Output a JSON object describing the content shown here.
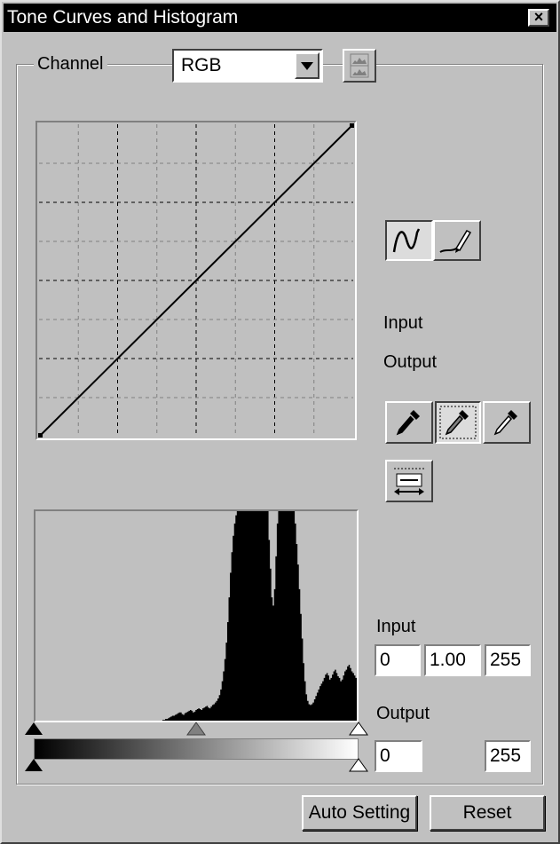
{
  "window": {
    "title": "Tone Curves and Histogram"
  },
  "channel": {
    "label": "Channel",
    "selected": "RGB"
  },
  "curve": {
    "points": [
      [
        0,
        0
      ],
      [
        255,
        255
      ]
    ]
  },
  "readout": {
    "input_label": "Input",
    "output_label": "Output"
  },
  "levels": {
    "input_label": "Input",
    "input_black": "0",
    "input_gamma": "1.00",
    "input_white": "255",
    "output_label": "Output",
    "output_black": "0",
    "output_white": "255"
  },
  "buttons": {
    "auto_setting": "Auto Setting",
    "reset": "Reset"
  },
  "icons": {
    "close": "close-icon",
    "histogram_toggle": "histogram-icon",
    "curve_tool": "curve-icon",
    "pencil_tool": "pencil-icon",
    "black_point": "eyedropper-black-icon",
    "gray_point": "eyedropper-gray-icon",
    "white_point": "eyedropper-white-icon",
    "auto_range": "auto-range-icon"
  },
  "histogram": {
    "values": [
      0,
      0,
      0,
      0,
      0,
      0,
      0,
      0,
      0,
      0,
      0,
      0,
      0,
      0,
      0,
      0,
      0,
      0,
      0,
      0,
      0,
      0,
      0,
      0,
      0,
      0,
      0,
      0,
      0,
      0,
      0,
      0,
      0,
      0,
      0,
      0,
      0,
      0,
      0,
      0,
      0,
      0,
      0,
      0,
      0,
      0,
      0,
      0,
      0,
      0,
      0,
      0,
      0,
      0,
      0,
      0,
      0,
      0,
      0,
      0,
      0,
      0,
      0,
      0,
      0,
      0,
      0,
      0,
      0,
      0,
      0,
      0,
      0,
      0,
      0,
      0,
      0,
      0,
      0,
      0,
      0,
      0,
      0,
      0,
      0,
      0,
      0,
      0,
      0,
      0,
      0,
      0,
      1,
      1,
      2,
      2,
      3,
      4,
      5,
      6,
      6,
      7,
      8,
      9,
      10,
      10,
      8,
      7,
      9,
      10,
      11,
      12,
      13,
      12,
      10,
      11,
      13,
      14,
      15,
      14,
      13,
      15,
      16,
      17,
      18,
      16,
      15,
      17,
      19,
      20,
      22,
      24,
      27,
      31,
      38,
      48,
      60,
      75,
      95,
      120,
      150,
      180,
      205,
      225,
      240,
      250,
      255,
      255,
      255,
      255,
      255,
      255,
      255,
      255,
      255,
      255,
      255,
      255,
      255,
      255,
      255,
      255,
      255,
      255,
      255,
      255,
      255,
      255,
      255,
      220,
      185,
      150,
      140,
      160,
      200,
      240,
      255,
      255,
      255,
      255,
      255,
      255,
      255,
      255,
      255,
      255,
      255,
      255,
      240,
      215,
      190,
      160,
      130,
      100,
      70,
      48,
      32,
      24,
      20,
      19,
      20,
      22,
      26,
      30,
      34,
      38,
      42,
      45,
      48,
      52,
      56,
      58,
      55,
      50,
      52,
      56,
      60,
      62,
      58,
      54,
      52,
      48,
      50,
      55,
      60,
      62,
      66,
      68,
      64,
      60,
      58,
      55,
      52
    ]
  },
  "colors": {
    "titlebar": "#000000",
    "face": "#c0c0c0"
  }
}
